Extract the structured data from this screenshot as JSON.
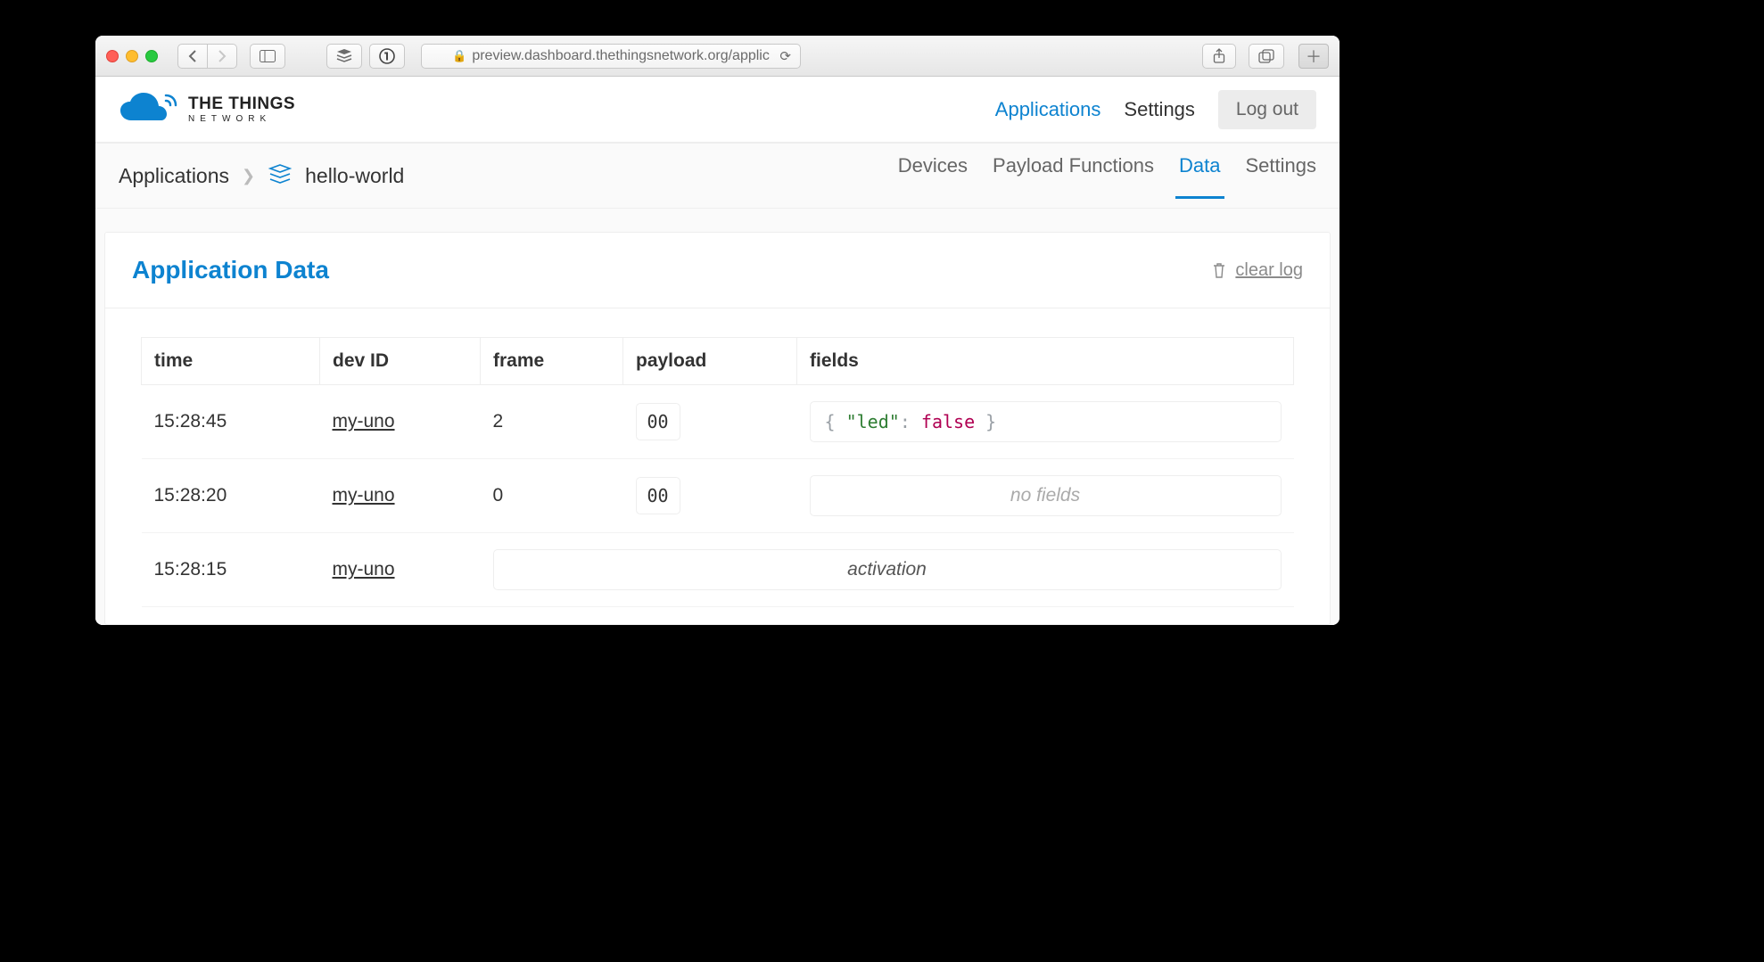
{
  "browser": {
    "url": "preview.dashboard.thethingsnetwork.org/applic"
  },
  "brand": {
    "line1": "THE THINGS",
    "line2": "NETWORK",
    "accent": "#0d83d0"
  },
  "topnav": {
    "applications": "Applications",
    "settings": "Settings",
    "logout": "Log out"
  },
  "breadcrumb": {
    "root": "Applications",
    "app": "hello-world"
  },
  "tabs": {
    "devices": "Devices",
    "payload": "Payload Functions",
    "data": "Data",
    "settings": "Settings"
  },
  "panel": {
    "title": "Application Data",
    "clear": "clear log"
  },
  "table": {
    "headers": {
      "time": "time",
      "dev": "dev ID",
      "frame": "frame",
      "payload": "payload",
      "fields": "fields"
    },
    "rows": [
      {
        "time": "15:28:45",
        "dev": "my-uno",
        "frame": "2",
        "payload": "00",
        "fields_key": "\"led\"",
        "fields_val": "false",
        "type": "fields"
      },
      {
        "time": "15:28:20",
        "dev": "my-uno",
        "frame": "0",
        "payload": "00",
        "nofields": "no fields",
        "type": "nofields"
      },
      {
        "time": "15:28:15",
        "dev": "my-uno",
        "activation": "activation",
        "type": "activation"
      }
    ]
  }
}
